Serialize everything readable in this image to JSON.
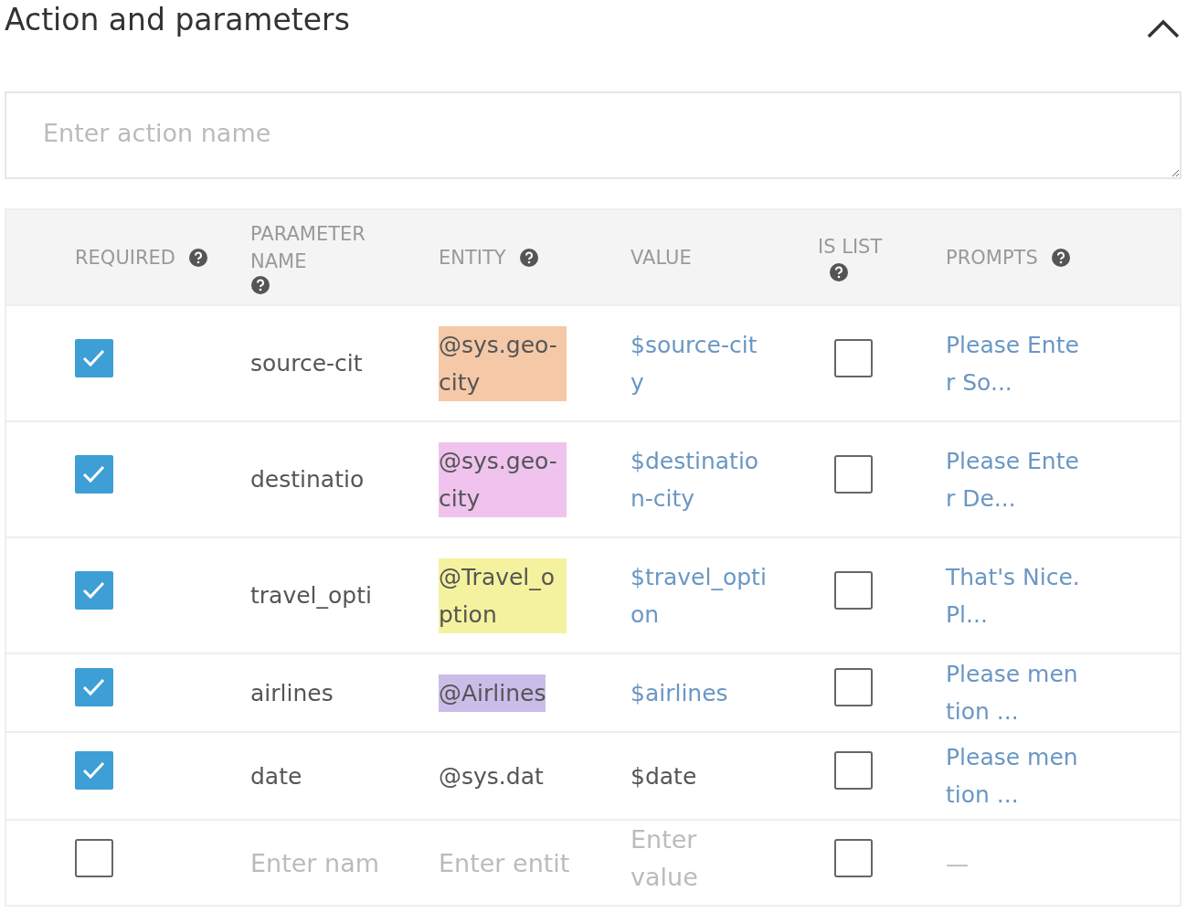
{
  "section": {
    "title": "Action and parameters",
    "expanded": true
  },
  "action_name": {
    "placeholder": "Enter action name"
  },
  "table": {
    "columns": [
      {
        "label": "REQUIRED",
        "help": true
      },
      {
        "label": "PARAMETER NAME",
        "help": true
      },
      {
        "label": "ENTITY",
        "help": true
      },
      {
        "label": "VALUE",
        "help": false
      },
      {
        "label": "IS LIST",
        "help": true
      },
      {
        "label": "PROMPTS",
        "help": true
      }
    ],
    "rows": [
      {
        "kind": "param",
        "required": true,
        "name": "source-cit",
        "entity": "@sys.geo-city",
        "color": "#f5c9a8",
        "value": "$source-city",
        "value_linked": true,
        "is_list": false,
        "prompt": "Please Enter So..."
      },
      {
        "kind": "param",
        "required": true,
        "name": "destinatio",
        "entity": "@sys.geo-city",
        "color": "#efc3ee",
        "value": "$destination-city",
        "value_linked": true,
        "is_list": false,
        "prompt": "Please Enter De..."
      },
      {
        "kind": "param",
        "required": true,
        "name": "travel_opti",
        "entity": "@Travel_option",
        "color": "#f5f29f",
        "value": "$travel_option",
        "value_linked": true,
        "is_list": false,
        "prompt": "That's Nice. Pl..."
      },
      {
        "kind": "param",
        "required": true,
        "name": "airlines",
        "entity": "@Airlines",
        "color": "#cbbde9",
        "value": "$airlines",
        "value_linked": true,
        "is_list": false,
        "prompt": "Please mention ..."
      },
      {
        "kind": "param",
        "required": true,
        "name": "date",
        "entity": "@sys.dat",
        "value": "$date",
        "value_linked": false,
        "is_list": false,
        "prompt": "Please mention ..."
      },
      {
        "kind": "new",
        "required": false,
        "name_placeholder": "Enter nam",
        "entity_placeholder": "Enter entit",
        "value_placeholder": "Enter value",
        "is_list": false,
        "prompt": "—"
      }
    ]
  }
}
